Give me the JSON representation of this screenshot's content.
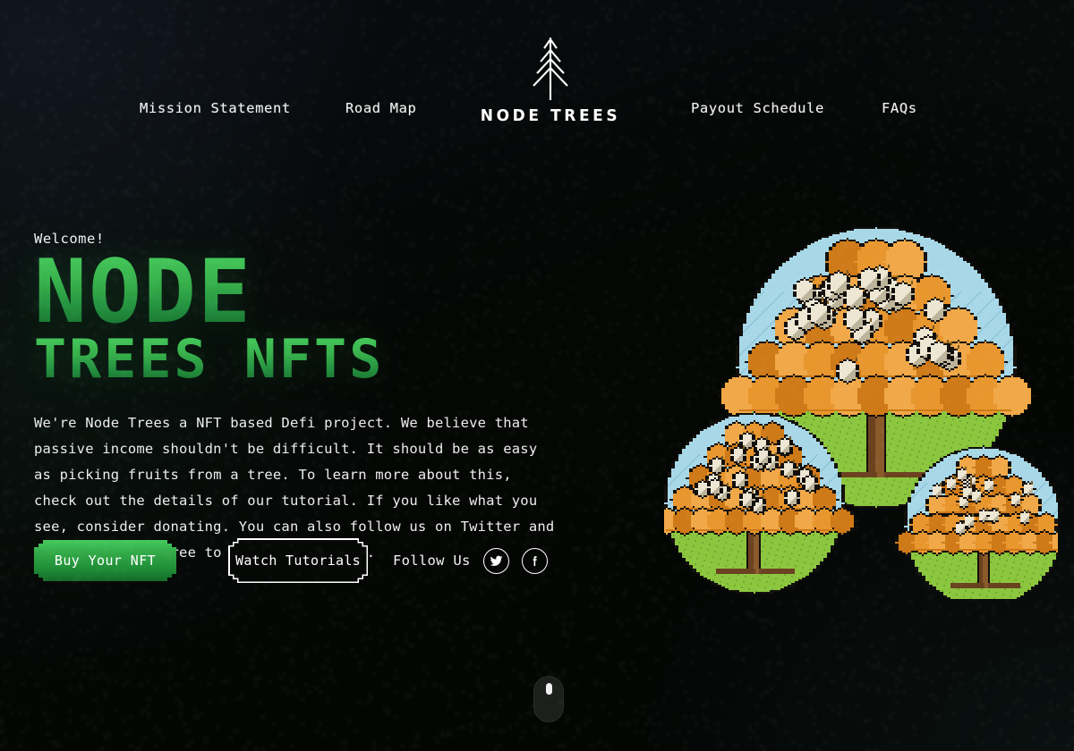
{
  "site": {
    "logo_word": "NODE TREES",
    "logo_icon": "pine-tree-icon"
  },
  "nav": {
    "items": [
      {
        "label": "Mission Statement"
      },
      {
        "label": "Road Map"
      },
      {
        "label": "Payout Schedule"
      },
      {
        "label": "FAQs"
      }
    ]
  },
  "hero": {
    "eyebrow": "Welcome!",
    "headline_line1": "NODE",
    "headline_line2": "TREES NFTS",
    "body": "We're Node Trees a NFT based Defi project. We believe that passive income shouldn't be difficult. It should be as easy as picking fruits from a tree. To learn more about this, check out the details of our tutorial. If you like what you see, consider donating. You can also follow us on Twitter and Facebook. Feel free to send us an email.",
    "primary_button": "Buy Your NFT",
    "secondary_button": "Watch Tutorials",
    "follow_label": "Follow Us",
    "social": [
      {
        "name": "twitter-icon",
        "label": "Twitter"
      },
      {
        "name": "facebook-icon",
        "label": "Facebook"
      }
    ]
  },
  "artwork": {
    "alt": "Three pixel-art circular badges of fruit trees",
    "trees": [
      {
        "name": "large-tree-badge",
        "size": "large"
      },
      {
        "name": "small-tree-badge-left",
        "size": "small"
      },
      {
        "name": "small-tree-badge-right",
        "size": "small"
      }
    ]
  },
  "scroll_hint": {
    "name": "mouse-scroll-icon"
  },
  "colors": {
    "background_dark": "#050705",
    "background_navy": "#11161f",
    "accent_green": "#33ab49",
    "accent_green_light": "#46c95c",
    "accent_green_dark": "#136b27",
    "text_white": "#f2f2f2",
    "foliage_orange": "#e8962e",
    "foliage_orange_light": "#f0a848",
    "fruit_cream": "#ede6d3",
    "sky_blue": "#a8d8e8",
    "grass_green": "#8cc63f",
    "trunk_brown": "#8b5a2b"
  }
}
